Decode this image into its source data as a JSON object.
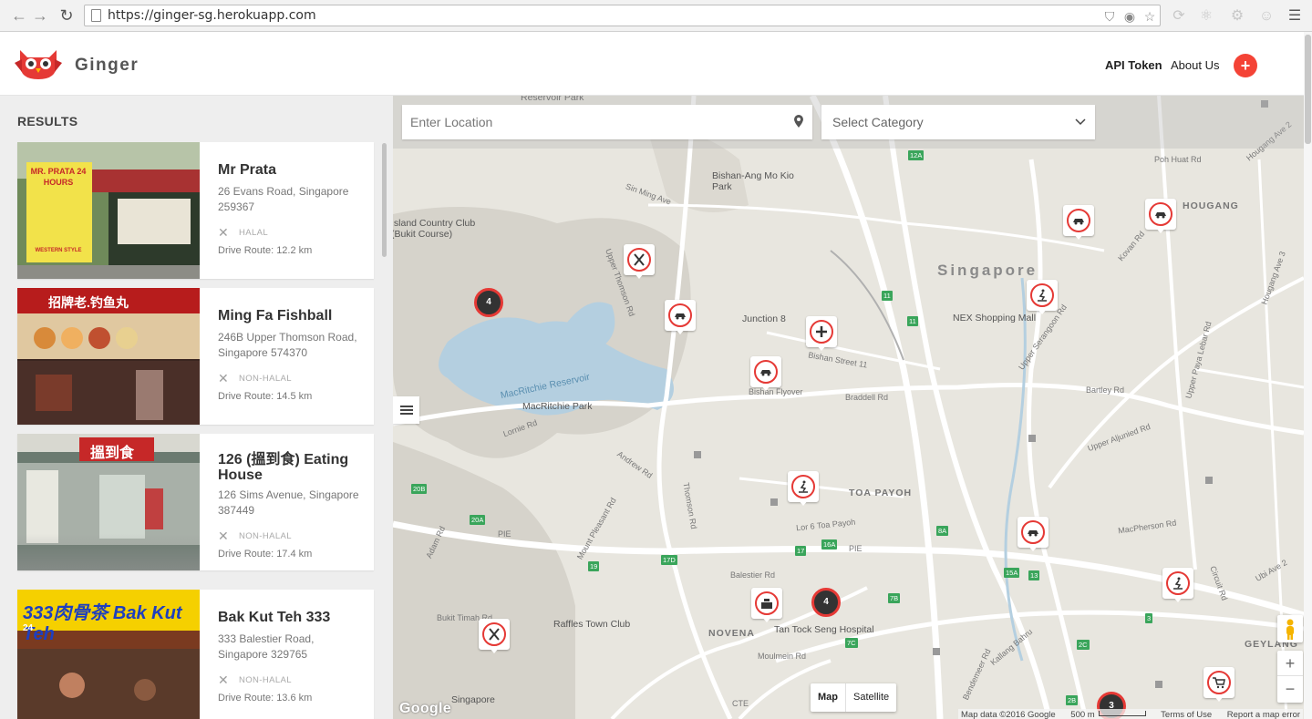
{
  "browser": {
    "url": "https://ginger-sg.herokuapp.com"
  },
  "header": {
    "brand": "Ginger",
    "nav": {
      "api_token": "API Token",
      "about_us": "About Us",
      "add_symbol": "+"
    },
    "accent": "#f44336"
  },
  "sidebar": {
    "title": "RESULTS",
    "results": [
      {
        "name": "Mr Prata",
        "address": "26 Evans Road, Singapore 259367",
        "halal": "HALAL",
        "drive": "Drive Route: 12.2 km"
      },
      {
        "name": "Ming Fa Fishball",
        "address": "246B Upper Thomson Road, Singapore 574370",
        "halal": "NON-HALAL",
        "drive": "Drive Route: 14.5 km"
      },
      {
        "name": "126 (搵到食) Eating House",
        "address": "126 Sims Avenue, Singapore 387449",
        "halal": "NON-HALAL",
        "drive": "Drive Route: 17.4 km"
      },
      {
        "name": "Bak Kut Teh 333",
        "address": "333 Balestier Road, Singapore 329765",
        "halal": "NON-HALAL",
        "drive": "Drive Route: 13.6 km"
      }
    ],
    "photo_signs": {
      "prata_sign": "MR. PRATA 24 HOURS",
      "prata_sub": "WESTERN STYLE",
      "mingfa_sign": "招牌老.钓鱼丸",
      "eating_sign": "搵到食",
      "bkt_sign": "333肉骨茶 Bak Kut Teh",
      "bkt_hours": "24"
    }
  },
  "map": {
    "search": {
      "placeholder": "Enter Location"
    },
    "category": {
      "value": "Select Category"
    },
    "labels": {
      "singapore": "Singapore",
      "reservoir_park": "Reservoir Park",
      "bishan_park": "Bishan-Ang Mo Kio Park",
      "country_club": "Island Country Club (Bukit Course)",
      "macritchie_reservoir": "MacRitchie Reservoir",
      "macritchie_park": "MacRitchie Park",
      "junction8": "Junction 8",
      "nex": "NEX Shopping Mall",
      "toa_payoh": "TOA PAYOH",
      "raffles_town": "Raffles Town Club",
      "tan_tock_seng": "Tan Tock Seng Hospital",
      "novena": "NOVENA",
      "geylang": "GEYLANG",
      "hougang": "HOUGANG",
      "singapore_bottom": "Singapore",
      "bishan_flyover": "Bishan Flyover",
      "braddell": "Braddell Rd",
      "bartley": "Bartley Rd",
      "macpherson": "MacPherson Rd",
      "pie": "PIE",
      "cte": "CTE",
      "thomson": "Thomson Rd",
      "upper_thomson": "Upper Thomson Rd",
      "lornie": "Lornie Rd",
      "adam": "Adam Rd",
      "andrew": "Andrew Rd",
      "balestier": "Balestier Rd",
      "moulmein": "Moulmein Rd",
      "bukit_timah": "Bukit Timah Rd",
      "sin_ming": "Sin Ming Ave",
      "lor6": "Lor 6 Toa Payoh",
      "bishan_st11": "Bishan Street 11",
      "mount_pleasant": "Mount Pleasant Rd",
      "upper_serangoon": "Upper Serangoon Rd",
      "kovan": "Kovan Rd",
      "upper_paya_lebar": "Upper Paya Lebar Rd",
      "poh_huat": "Poh Huat Rd",
      "hougang_ave2": "Hougang Ave 2",
      "hougang_ave3": "Hougang Ave 3",
      "upper_aljunied": "Upper Aljunied Rd",
      "kallang_bahru": "Kallang Bahru",
      "bendemeer": "Bendemeer Rd",
      "circuit": "Circuit Rd",
      "ubi": "Ubi Ave 2"
    },
    "shields": [
      "12A",
      "11",
      "11",
      "20B",
      "20A",
      "19",
      "17D",
      "17",
      "16A",
      "8A",
      "7B",
      "7C",
      "15A",
      "13",
      "2C",
      "3",
      "2B"
    ],
    "clusters": [
      "4",
      "4",
      "3"
    ],
    "maptype": {
      "map": "Map",
      "satellite": "Satellite"
    },
    "zoom": {
      "in": "+",
      "out": "−"
    },
    "google": "Google",
    "attribution": {
      "data": "Map data ©2016 Google",
      "scale": "500 m",
      "terms": "Terms of Use",
      "report": "Report a map error"
    }
  }
}
